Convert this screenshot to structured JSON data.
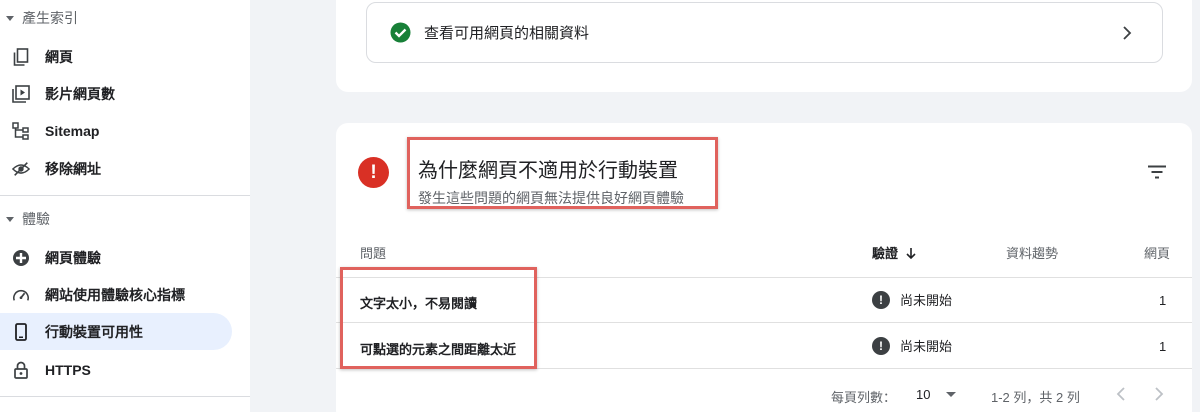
{
  "sidebar": {
    "section1": "產生索引",
    "items1": [
      {
        "label": "網頁",
        "icon": "pages-icon"
      },
      {
        "label": "影片網頁數",
        "icon": "video-pages-icon"
      },
      {
        "label": "Sitemap",
        "icon": "sitemap-icon"
      },
      {
        "label": "移除網址",
        "icon": "removals-icon"
      }
    ],
    "section2": "體驗",
    "items2": [
      {
        "label": "網頁體驗",
        "icon": "page-experience-icon"
      },
      {
        "label": "網站使用體驗核心指標",
        "icon": "gauge-icon"
      },
      {
        "label": "行動裝置可用性",
        "icon": "mobile-icon",
        "active": true
      },
      {
        "label": "HTTPS",
        "icon": "lock-icon"
      }
    ]
  },
  "valid_card": {
    "label": "查看可用網頁的相關資料"
  },
  "issues_card": {
    "title": "為什麼網頁不適用於行動裝置",
    "subtitle": "發生這些問題的網頁無法提供良好網頁體驗",
    "columns": {
      "issue": "問題",
      "validation": "驗證",
      "trend": "資料趨勢",
      "pages": "網頁"
    },
    "rows": [
      {
        "issue": "文字太小，不易閱讀",
        "status": "尚未開始",
        "pages": "1"
      },
      {
        "issue": "可點選的元素之間距離太近",
        "status": "尚未開始",
        "pages": "1"
      }
    ],
    "footer": {
      "rows_per_page_label": "每頁列數：",
      "rows_per_page_value": "10",
      "range": "1-2 列，共 2 列"
    }
  },
  "colors": {
    "error": "#d93025",
    "success": "#188038",
    "highlight_border": "#e0625d",
    "active_nav": "#e8f0fe"
  }
}
